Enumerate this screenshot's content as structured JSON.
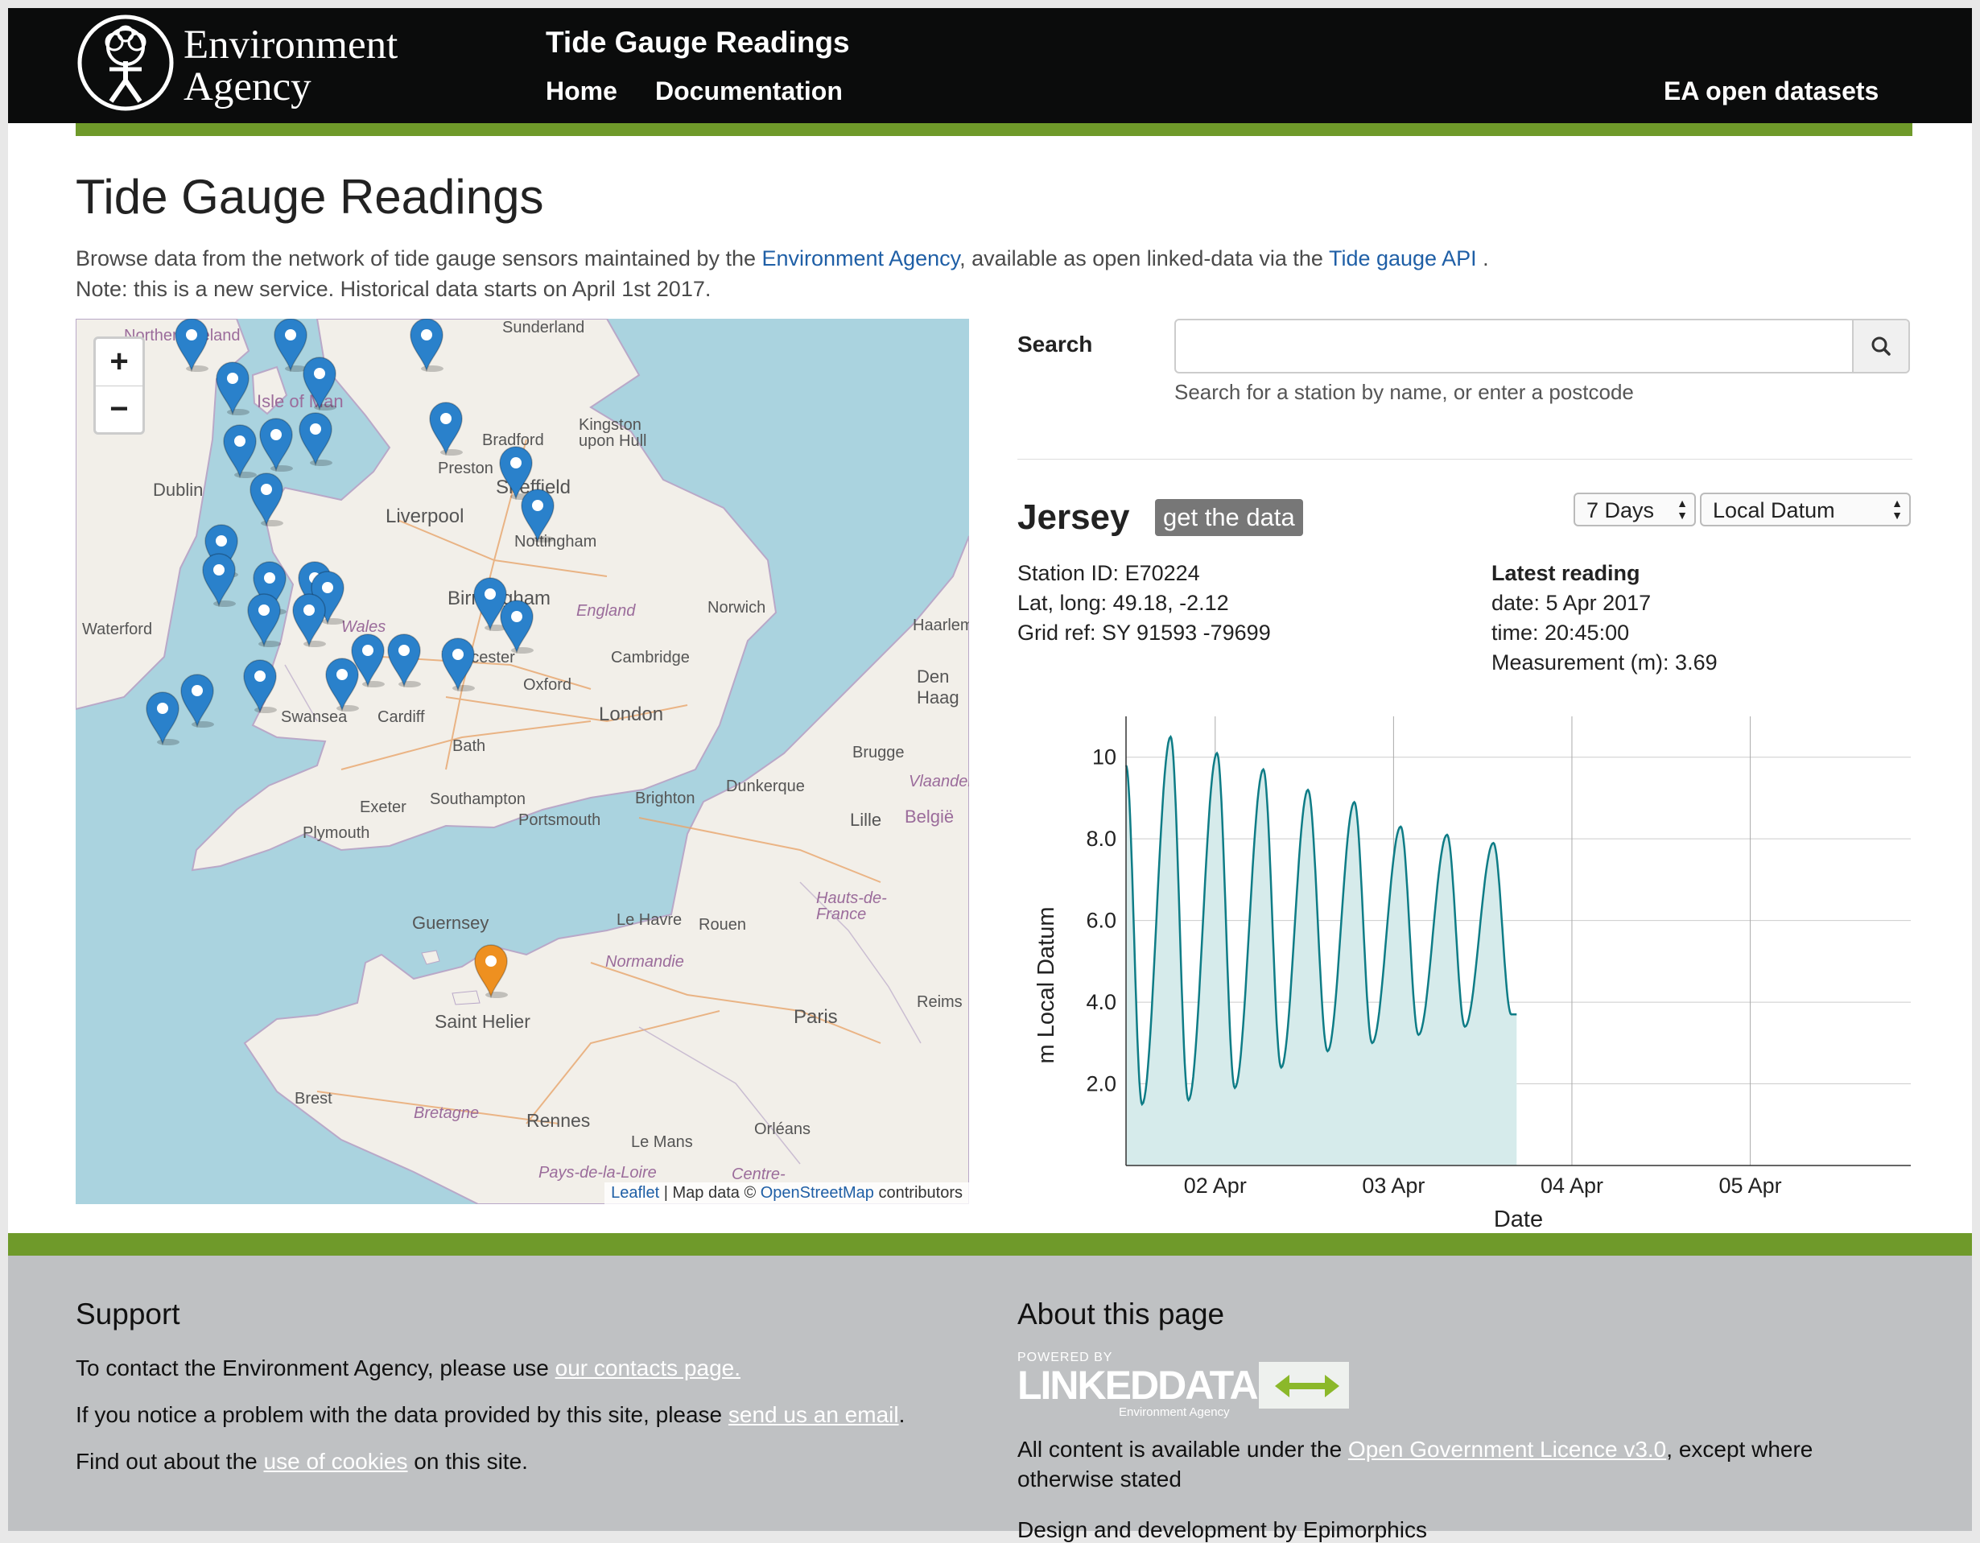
{
  "header": {
    "logo_line1": "Environment",
    "logo_line2": "Agency",
    "site_title": "Tide Gauge Readings",
    "nav": {
      "home": "Home",
      "documentation": "Documentation",
      "open_datasets": "EA open datasets"
    }
  },
  "intro": {
    "title": "Tide Gauge Readings",
    "text_before": "Browse data from the network of tide gauge sensors maintained by the ",
    "link1": "Environment Agency",
    "text_middle": ", available as open linked-data via the ",
    "link2": "Tide gauge API",
    "text_after": " . Note: this is a new service. Historical data starts on April 1st 2017."
  },
  "map": {
    "zoom_in": "+",
    "zoom_out": "−",
    "labels": {
      "northern_ireland": "Northern Ireland",
      "isle_of_man": "Isle of Man",
      "dublin": "Dublin",
      "waterford": "Waterford",
      "sunderland": "Sunderland",
      "bradford": "Bradford",
      "preston": "Preston",
      "liverpool": "Liverpool",
      "sheffield": "Sheffield",
      "kingston": "Kingston upon Hull",
      "nottingham": "Nottingham",
      "birmingham": "Birmingham",
      "england": "England",
      "wales": "Wales",
      "norwich": "Norwich",
      "worcester": "Worcester",
      "cambridge": "Cambridge",
      "oxford": "Oxford",
      "london": "London",
      "swansea": "Swansea",
      "cardiff": "Cardiff",
      "bath": "Bath",
      "brighton": "Brighton",
      "exeter": "Exeter",
      "plymouth": "Plymouth",
      "southampton": "Southampton",
      "portsmouth": "Portsmouth",
      "dunkerque": "Dunkerque",
      "brugge": "Brugge",
      "lille": "Lille",
      "belgie": "België",
      "vlaanderen": "Vlaanderen",
      "haarlem": "Haarlem",
      "den_haag": "Den Haag",
      "hauts_de_france": "Hauts-de-France",
      "guernsey": "Guernsey",
      "saint_helier": "Saint Helier",
      "le_havre": "Le Havre",
      "rouen": "Rouen",
      "normandie": "Normandie",
      "paris": "Paris",
      "reims": "Reims",
      "brest": "Brest",
      "bretagne": "Bretagne",
      "rennes": "Rennes",
      "le_mans": "Le Mans",
      "orleans": "Orléans",
      "pays_de_la_loire": "Pays-de-la-Loire",
      "centre": "Centre-"
    },
    "attribution": {
      "leaflet": "Leaflet",
      "sep": " | Map data © ",
      "osm": "OpenStreetMap",
      "tail": " contributors"
    },
    "colors": {
      "sea": "#aad3df",
      "land": "#f2efe9",
      "marker_blue": "#2a81cb",
      "marker_orange": "#ee9020"
    }
  },
  "search": {
    "label": "Search",
    "value": "",
    "placeholder": "",
    "help": "Search for a station by name, or enter a postcode",
    "button_icon": "search-icon"
  },
  "station": {
    "name": "Jersey",
    "get_data_label": "get the data",
    "period_select": "7 Days",
    "datum_select": "Local Datum",
    "station_id": "Station ID: E70224",
    "lat_long": "Lat, long: 49.18, -2.12",
    "grid_ref": "Grid ref: SY 91593 -79699",
    "latest_title": "Latest reading",
    "latest_date": "date: 5 Apr 2017",
    "latest_time": "time: 20:45:00",
    "latest_measurement": "Measurement (m): 3.69"
  },
  "chart_data": {
    "type": "area",
    "xlabel": "Date",
    "ylabel": "m Local Datum",
    "x_ticks": [
      "02 Apr",
      "03 Apr",
      "04 Apr",
      "05 Apr"
    ],
    "y_ticks": [
      "2.0",
      "4.0",
      "6.0",
      "8.0",
      "10"
    ],
    "ylim": [
      0.0,
      11.0
    ],
    "x_range_days": [
      1.5,
      5.9
    ],
    "series": [
      {
        "points": [
          [
            1.5,
            9.8
          ],
          [
            1.59,
            1.5
          ],
          [
            1.75,
            10.5
          ],
          [
            1.85,
            1.6
          ],
          [
            2.01,
            10.1
          ],
          [
            2.11,
            1.9
          ],
          [
            2.27,
            9.7
          ],
          [
            2.37,
            2.4
          ],
          [
            2.52,
            9.2
          ],
          [
            2.63,
            2.8
          ],
          [
            2.78,
            8.9
          ],
          [
            2.88,
            3.0
          ],
          [
            3.04,
            8.3
          ],
          [
            3.14,
            3.2
          ],
          [
            3.3,
            8.1
          ],
          [
            3.4,
            3.4
          ],
          [
            3.56,
            7.9
          ],
          [
            3.66,
            3.7
          ],
          [
            3.69,
            3.7
          ]
        ]
      }
    ],
    "grid": true,
    "colors": {
      "line": "#0e7c86",
      "fill": "#d6ebeb"
    }
  },
  "footer": {
    "support_title": "Support",
    "line1_text": "To contact the Environment Agency, please use ",
    "line1_link": "our contacts page.",
    "line2_text": "If you notice a problem with the data provided by this site, please ",
    "line2_link": "send us an email",
    "line2_tail": ".",
    "line3_text": "Find out about the ",
    "line3_link": "use of cookies",
    "line3_tail": " on this site.",
    "about_title": "About this page",
    "ld_powered": "POWERED BY",
    "ld_name": "LINKEDDATA",
    "ld_sub": "Environment Agency",
    "licence_text": "All content is available under the ",
    "licence_link": "Open Government Licence v3.0",
    "licence_tail": ", except where otherwise stated",
    "design": "Design and development by Epimorphics"
  }
}
